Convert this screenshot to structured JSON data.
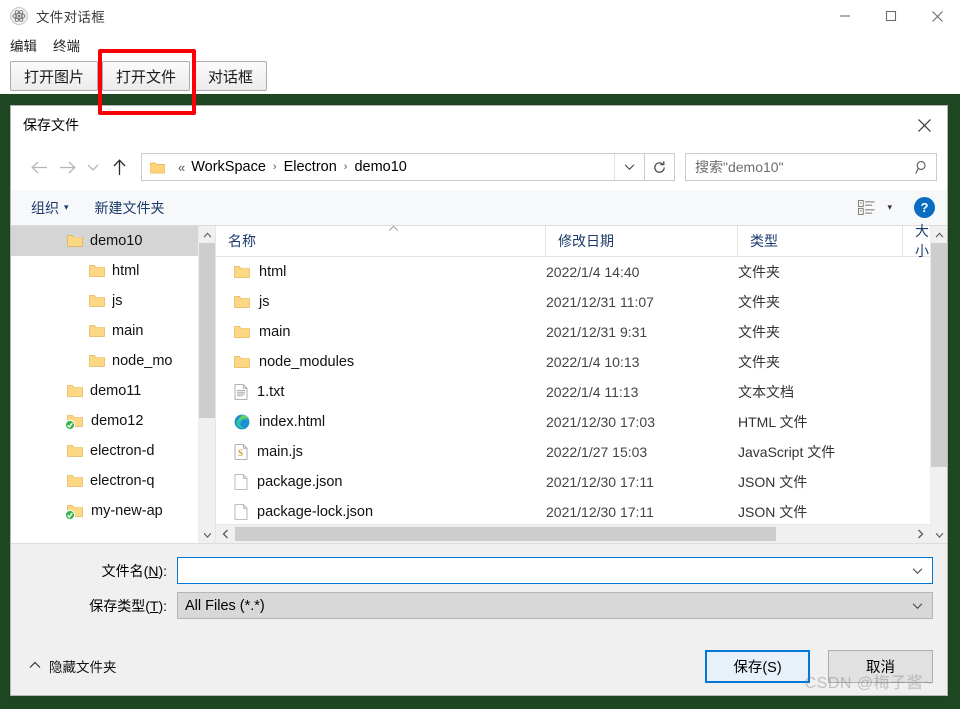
{
  "app": {
    "title": "文件对话框",
    "icon": "electron-icon",
    "window_controls": [
      {
        "name": "minimize-button",
        "glyph": "—"
      },
      {
        "name": "maximize-button",
        "glyph": "□"
      },
      {
        "name": "close-button",
        "glyph": "✕"
      }
    ],
    "menu": [
      {
        "label": "编辑"
      },
      {
        "label": "终端"
      }
    ],
    "buttons": [
      {
        "label": "打开图片",
        "name": "open-image-button"
      },
      {
        "label": "打开文件",
        "name": "open-file-button"
      },
      {
        "label": "对话框",
        "name": "dialog-button"
      }
    ],
    "content_bg": "#1e4620"
  },
  "annotation": {
    "color": "#fb0007",
    "target": "打开文件"
  },
  "dialog": {
    "title": "保存文件",
    "close_label": "✕",
    "nav": {
      "back": "←",
      "forward": "→",
      "history": "⌄",
      "up": "↑",
      "breadcrumb": {
        "prefix": "«",
        "parts": [
          "WorkSpace",
          "Electron",
          "demo10"
        ],
        "separator": "›",
        "dropdown": "⌄"
      },
      "refresh": "↻",
      "search_placeholder": "搜索\"demo10\""
    },
    "commandbar": {
      "organize": "组织",
      "organize_caret": "▾",
      "new_folder": "新建文件夹",
      "view_caret": "▾",
      "help": "?"
    },
    "tree": [
      {
        "label": "demo10",
        "indent": 2,
        "icon": "folder",
        "selected": true
      },
      {
        "label": "html",
        "indent": 3,
        "icon": "folder",
        "selected": false
      },
      {
        "label": "js",
        "indent": 3,
        "icon": "folder",
        "selected": false
      },
      {
        "label": "main",
        "indent": 3,
        "icon": "folder",
        "selected": false
      },
      {
        "label": "node_mo",
        "indent": 3,
        "icon": "folder",
        "selected": false
      },
      {
        "label": "demo11",
        "indent": 2,
        "icon": "folder",
        "selected": false
      },
      {
        "label": "demo12",
        "indent": 2,
        "icon": "folder-sync",
        "selected": false
      },
      {
        "label": "electron-d",
        "indent": 2,
        "icon": "folder",
        "selected": false
      },
      {
        "label": "electron-q",
        "indent": 2,
        "icon": "folder",
        "selected": false
      },
      {
        "label": "my-new-ap",
        "indent": 2,
        "icon": "folder-sync",
        "selected": false
      }
    ],
    "columns": [
      {
        "label": "名称",
        "name": "column-name"
      },
      {
        "label": "修改日期",
        "name": "column-date"
      },
      {
        "label": "类型",
        "name": "column-type"
      },
      {
        "label": "大小",
        "name": "column-size"
      }
    ],
    "files": [
      {
        "name": "html",
        "date": "2022/1/4 14:40",
        "type": "文件夹",
        "size": "",
        "icon": "folder"
      },
      {
        "name": "js",
        "date": "2021/12/31 11:07",
        "type": "文件夹",
        "size": "",
        "icon": "folder"
      },
      {
        "name": "main",
        "date": "2021/12/31 9:31",
        "type": "文件夹",
        "size": "",
        "icon": "folder"
      },
      {
        "name": "node_modules",
        "date": "2022/1/4 10:13",
        "type": "文件夹",
        "size": "",
        "icon": "folder"
      },
      {
        "name": "1.txt",
        "date": "2022/1/4 11:13",
        "type": "文本文档",
        "size": "",
        "icon": "text-file"
      },
      {
        "name": "index.html",
        "date": "2021/12/30 17:03",
        "type": "HTML 文件",
        "size": "",
        "icon": "edge-browser"
      },
      {
        "name": "main.js",
        "date": "2022/1/27 15:03",
        "type": "JavaScript 文件",
        "size": "",
        "icon": "script-file"
      },
      {
        "name": "package.json",
        "date": "2021/12/30 17:11",
        "type": "JSON 文件",
        "size": "",
        "icon": "blank-file"
      },
      {
        "name": "package-lock.json",
        "date": "2021/12/30 17:11",
        "type": "JSON 文件",
        "size": "",
        "icon": "blank-file"
      }
    ],
    "form": {
      "filename_label_pre": "文件名(",
      "filename_label_key": "N",
      "filename_label_post": "):",
      "filename_value": "",
      "savetype_label_pre": "保存类型(",
      "savetype_label_key": "T",
      "savetype_label_post": "):",
      "savetype_value": "All Files (*.*)",
      "caret": "⌄"
    },
    "footer": {
      "hide_folders": "隐藏文件夹",
      "hide_chevron": "⌃",
      "save_label": "保存(S)",
      "cancel_label": "取消"
    }
  },
  "watermark": "CSDN @梅子酱~"
}
